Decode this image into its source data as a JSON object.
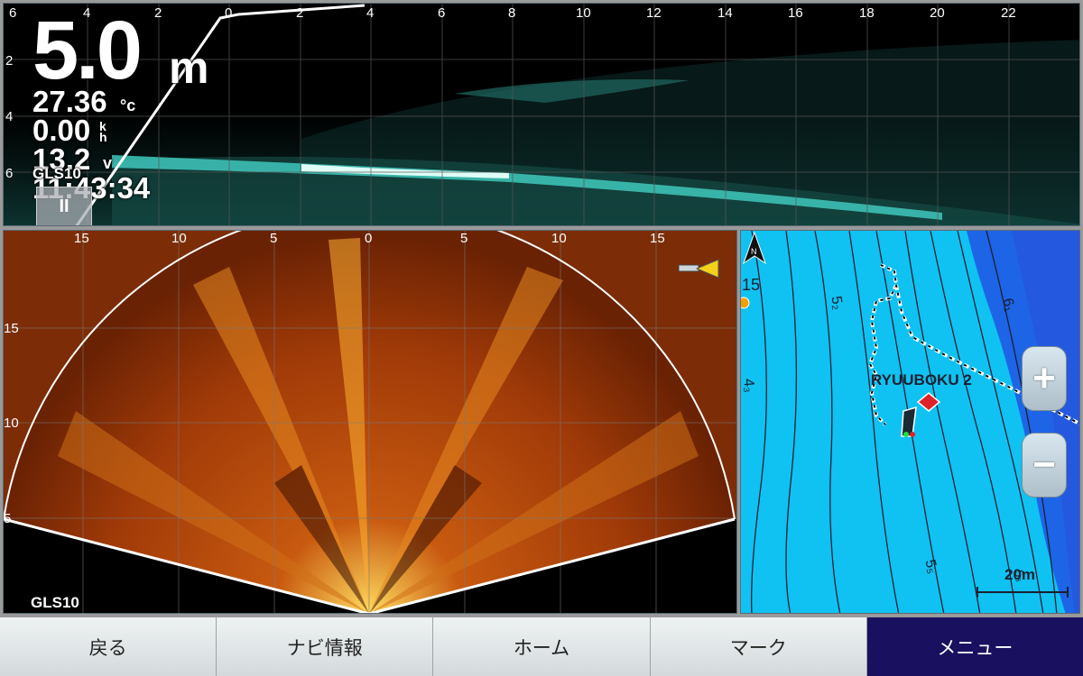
{
  "top_sonar": {
    "depth_value": "5.0",
    "depth_unit": "m",
    "water_temp": "27.36",
    "temp_unit": "°c",
    "speed": "0.00",
    "speed_unit": "k\nh",
    "voltage": "13.2",
    "voltage_unit": "v",
    "source": "GLS10",
    "clock": "11:43:34",
    "pause_label": "II",
    "range_labels": [
      "6",
      "4",
      "2",
      "0",
      "2",
      "4",
      "6",
      "8",
      "10",
      "12",
      "14",
      "16",
      "18",
      "20",
      "22"
    ],
    "depth_labels": [
      "2",
      "4",
      "6"
    ]
  },
  "livescope": {
    "source": "GLS10",
    "range_labels": [
      "15",
      "10",
      "5",
      "0",
      "5",
      "10",
      "15"
    ],
    "depth_labels": [
      "15",
      "10",
      "5"
    ]
  },
  "map": {
    "waypoint_name": "RYUUBOKU 2",
    "scale_label": "20m",
    "zoom_in_label": "+",
    "zoom_out_label": "−",
    "compass_letter": "N",
    "contour_labels": [
      "15",
      "5₂",
      "6₁",
      "4₃",
      "5₅",
      "5₈"
    ],
    "colors": {
      "water_shallow": "#0fc2f2",
      "water_deep": "#1e64e6",
      "contour": "#1a2030"
    }
  },
  "softkeys": [
    {
      "label": "戻る",
      "active": false
    },
    {
      "label": "ナビ情報",
      "active": false
    },
    {
      "label": "ホーム",
      "active": false
    },
    {
      "label": "マーク",
      "active": false
    },
    {
      "label": "メニュー",
      "active": true
    }
  ]
}
